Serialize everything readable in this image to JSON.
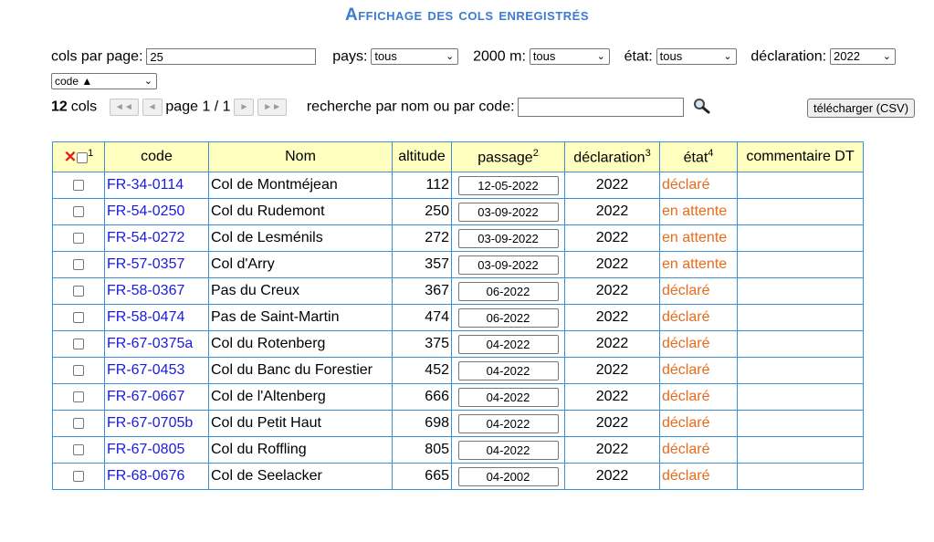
{
  "title": "Affichage des cols enregistrés",
  "filters": {
    "per_page_label": "cols par page:",
    "per_page_value": "25",
    "pays_label": "pays:",
    "pays_value": "tous",
    "m2000_label": "2000 m:",
    "m2000_value": "tous",
    "etat_label": "état:",
    "etat_value": "tous",
    "declaration_label": "déclaration:",
    "declaration_value": "2022",
    "sort_value": "code ▲"
  },
  "pager": {
    "count": "12",
    "count_label": "cols",
    "first": "◄◄",
    "prev": "◄",
    "page_text": "page 1 / 1",
    "next": "►",
    "last": "►►",
    "search_label": "recherche par nom ou par code:",
    "search_value": "",
    "search_icon": "magnifier-icon",
    "download_label": "télécharger (CSV)"
  },
  "table": {
    "headers": {
      "select_sup": "1",
      "code": "code",
      "nom": "Nom",
      "altitude": "altitude",
      "passage": "passage",
      "passage_sup": "2",
      "declaration": "déclaration",
      "declaration_sup": "3",
      "etat": "état",
      "etat_sup": "4",
      "commentaire": "commentaire DT"
    },
    "rows": [
      {
        "code": "FR-34-0114",
        "nom": "Col de Montméjean",
        "altitude": "112",
        "passage": "12-05-2022",
        "declaration": "2022",
        "etat": "déclaré",
        "commentaire": ""
      },
      {
        "code": "FR-54-0250",
        "nom": "Col du Rudemont",
        "altitude": "250",
        "passage": "03-09-2022",
        "declaration": "2022",
        "etat": "en attente",
        "commentaire": ""
      },
      {
        "code": "FR-54-0272",
        "nom": "Col de Lesménils",
        "altitude": "272",
        "passage": "03-09-2022",
        "declaration": "2022",
        "etat": "en attente",
        "commentaire": ""
      },
      {
        "code": "FR-57-0357",
        "nom": "Col d'Arry",
        "altitude": "357",
        "passage": "03-09-2022",
        "declaration": "2022",
        "etat": "en attente",
        "commentaire": ""
      },
      {
        "code": "FR-58-0367",
        "nom": "Pas du Creux",
        "altitude": "367",
        "passage": "06-2022",
        "declaration": "2022",
        "etat": "déclaré",
        "commentaire": ""
      },
      {
        "code": "FR-58-0474",
        "nom": "Pas de Saint-Martin",
        "altitude": "474",
        "passage": "06-2022",
        "declaration": "2022",
        "etat": "déclaré",
        "commentaire": ""
      },
      {
        "code": "FR-67-0375a",
        "nom": "Col du Rotenberg",
        "altitude": "375",
        "passage": "04-2022",
        "declaration": "2022",
        "etat": "déclaré",
        "commentaire": ""
      },
      {
        "code": "FR-67-0453",
        "nom": "Col du Banc du Forestier",
        "altitude": "452",
        "passage": "04-2022",
        "declaration": "2022",
        "etat": "déclaré",
        "commentaire": ""
      },
      {
        "code": "FR-67-0667",
        "nom": "Col de l'Altenberg",
        "altitude": "666",
        "passage": "04-2022",
        "declaration": "2022",
        "etat": "déclaré",
        "commentaire": ""
      },
      {
        "code": "FR-67-0705b",
        "nom": "Col du Petit Haut",
        "altitude": "698",
        "passage": "04-2022",
        "declaration": "2022",
        "etat": "déclaré",
        "commentaire": ""
      },
      {
        "code": "FR-67-0805",
        "nom": "Col du Roffling",
        "altitude": "805",
        "passage": "04-2022",
        "declaration": "2022",
        "etat": "déclaré",
        "commentaire": ""
      },
      {
        "code": "FR-68-0676",
        "nom": "Col de Seelacker",
        "altitude": "665",
        "passage": "04-2002",
        "declaration": "2022",
        "etat": "déclaré",
        "commentaire": ""
      }
    ]
  },
  "colors": {
    "title": "#3b7bd1",
    "code_link": "#1a1ae0",
    "etat": "#e86a1a",
    "header_bg": "#ffffc0",
    "border": "#3a8fd6"
  }
}
